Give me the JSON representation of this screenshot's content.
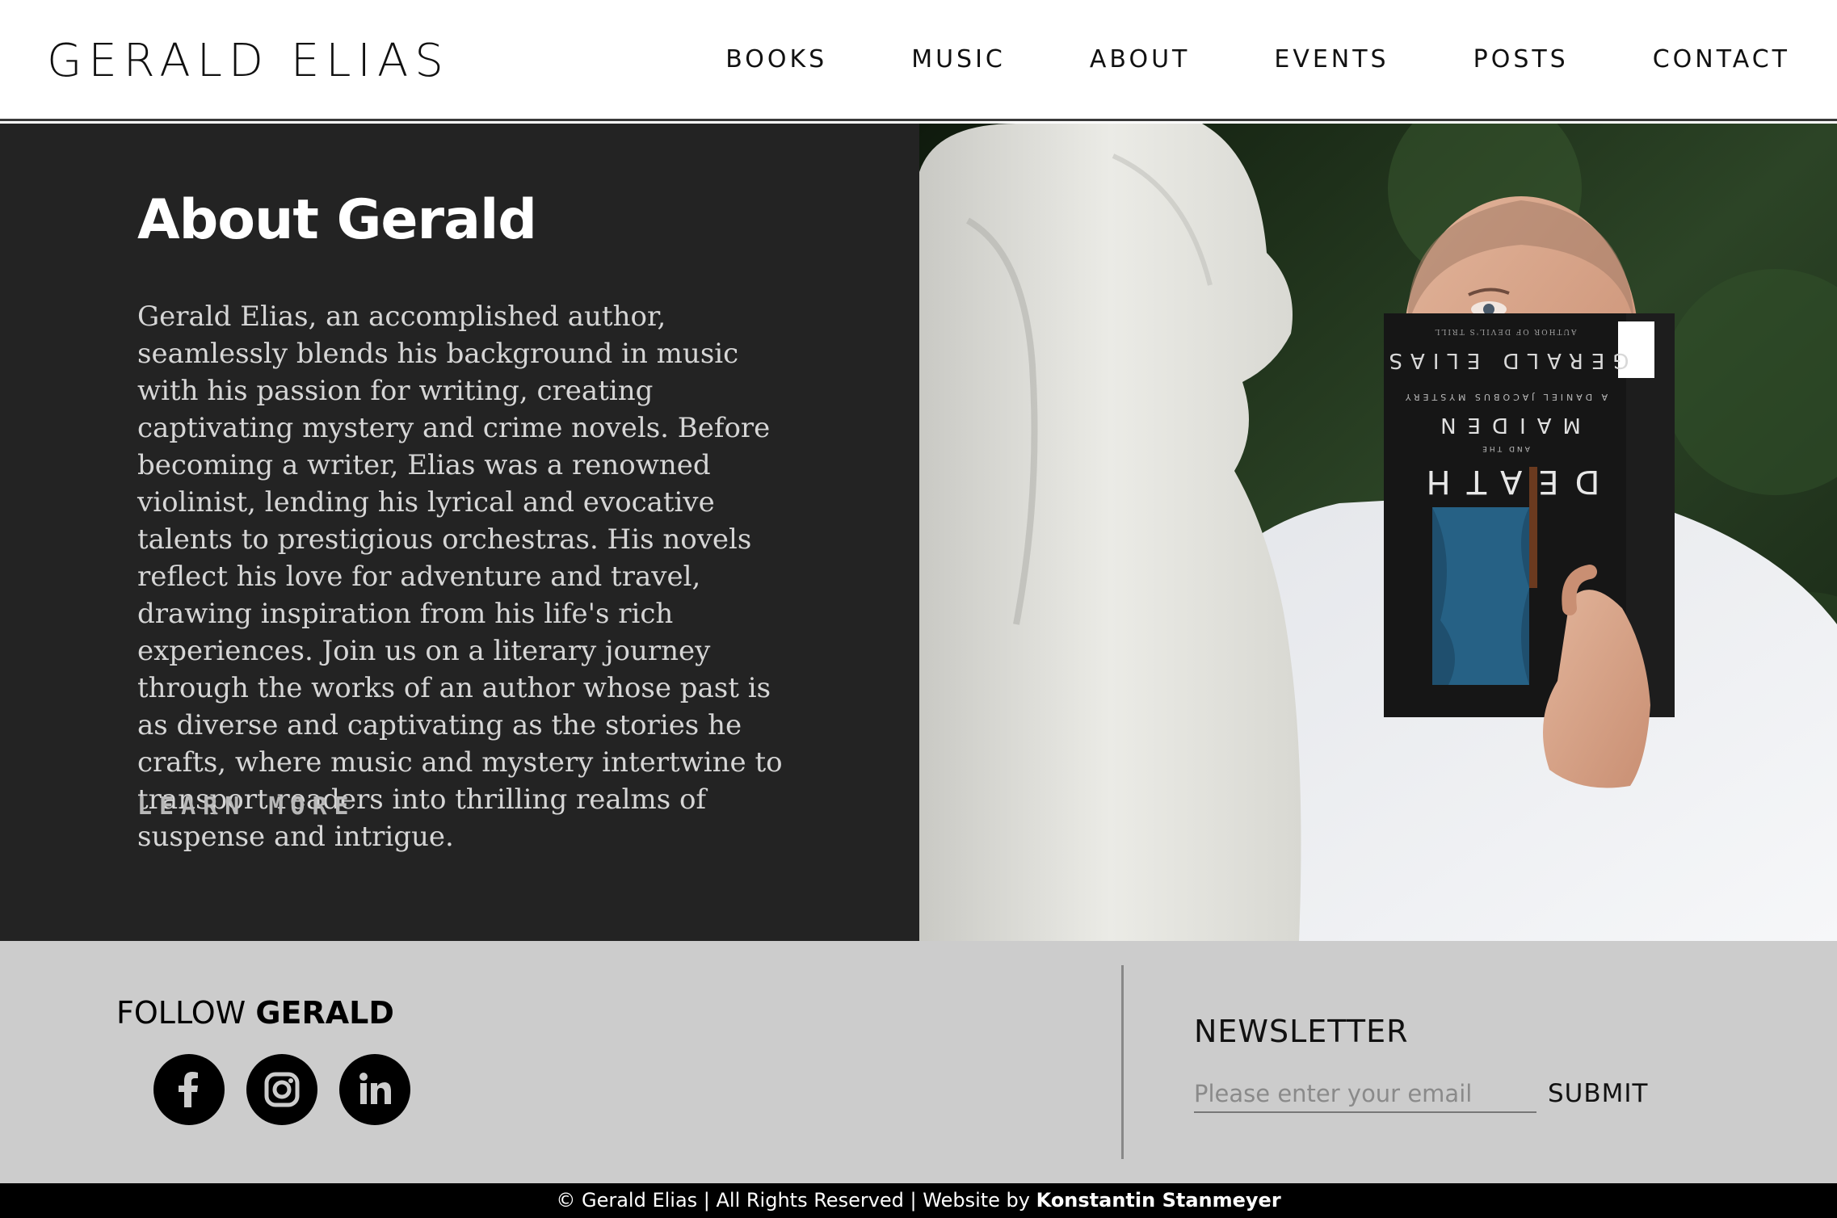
{
  "header": {
    "logo": "GERALD ELIAS",
    "nav": [
      "BOOKS",
      "MUSIC",
      "ABOUT",
      "EVENTS",
      "POSTS",
      "CONTACT"
    ]
  },
  "about": {
    "title": "About Gerald",
    "body": "Gerald Elias, an accomplished author, seamlessly blends his background in music with his passion for writing, creating captivating mystery and crime novels. Before becoming a writer, Elias was a renowned violinist, lending his lyrical and evocative talents to prestigious orchestras. His novels reflect his love for adventure and travel, drawing inspiration from his life's rich experiences. Join us on a literary journey through the works of an author whose past is as diverse and captivating as the stories he crafts, where music and mystery intertwine to transport readers into thrilling realms of suspense and intrigue.",
    "cta": "LEARN MORE"
  },
  "photo": {
    "book_author": "GERALD ELIAS",
    "book_series": "A DANIEL JACOBUS MYSTERY",
    "book_title_1": "DEATH",
    "book_title_2": "AND THE",
    "book_title_3": "MAIDEN",
    "book_tagline": "AUTHOR OF DEVIL'S TRILL"
  },
  "footer": {
    "follow_prefix": "FOLLOW",
    "follow_name": "GERALD",
    "socials": [
      "facebook-icon",
      "instagram-icon",
      "linkedin-icon"
    ],
    "newsletter_title": "NEWSLETTER",
    "email_placeholder": "Please enter your email",
    "submit_label": "SUBMIT"
  },
  "copyright": {
    "text": "© Gerald Elias | All Rights Reserved | Website by",
    "credit": "Konstantin Stanmeyer"
  },
  "colors": {
    "panel": "#232323",
    "footer": "#cccccc",
    "book_blue": "#1f4f6e"
  }
}
